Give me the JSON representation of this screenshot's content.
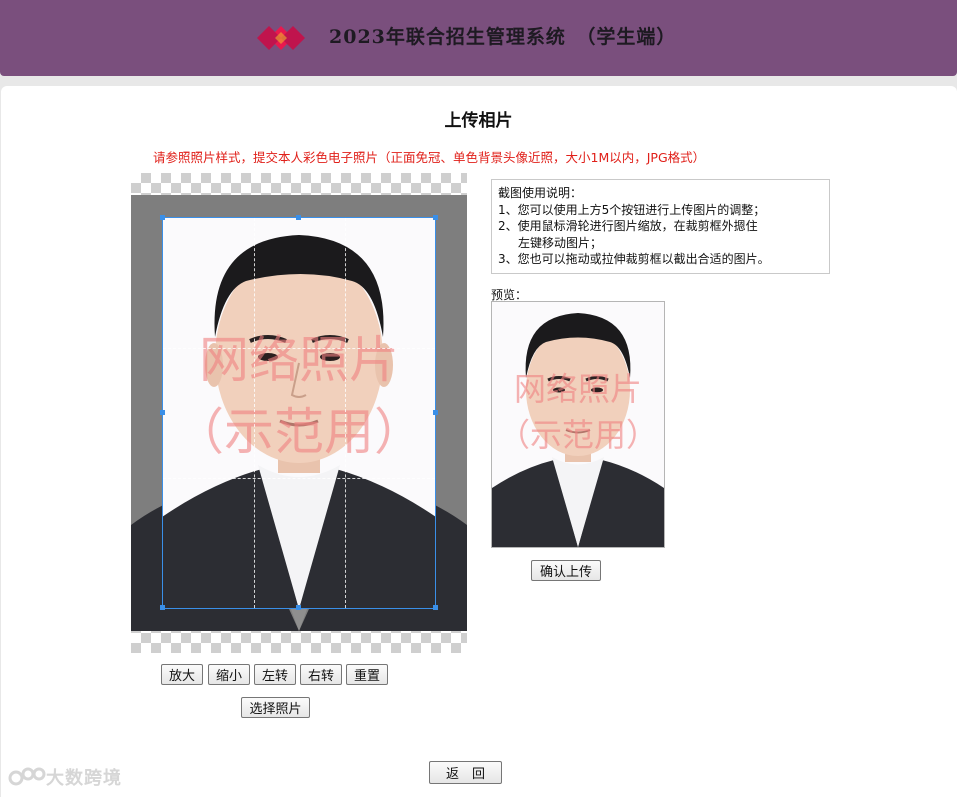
{
  "header": {
    "title": "2023年联合招生管理系统　（学生端）",
    "brand_colors": [
      "#c0144d",
      "#e8194f",
      "#f2c02a"
    ],
    "background": "#7a4f7d"
  },
  "page": {
    "title": "上传相片",
    "notice": "请参照照片样式，提交本人彩色电子照片（正面免冠、单色背景头像近照，大小1M以内，JPG格式）",
    "notice_color": "#e0201a"
  },
  "cropper": {
    "watermark_line1": "网络照片",
    "watermark_line2": "（示范用）"
  },
  "instructions": {
    "title": "截图使用说明：",
    "items": [
      "1、您可以使用上方5个按钮进行上传图片的调整；",
      "2、使用鼠标滑轮进行图片缩放，在裁剪框外摁住",
      "左键移动图片；",
      "3、您也可以拖动或拉伸裁剪框以截出合适的图片。"
    ]
  },
  "preview": {
    "label": "预览：",
    "watermark_line1": "网络照片",
    "watermark_line2": "（示范用）"
  },
  "buttons": {
    "zoom_in": "放大",
    "zoom_out": "缩小",
    "rotate_left": "左转",
    "rotate_right": "右转",
    "reset": "重置",
    "choose_photo": "选择照片",
    "confirm_upload": "确认上传",
    "back": "返　回"
  },
  "footer_watermark": {
    "text": "大数跨境"
  }
}
